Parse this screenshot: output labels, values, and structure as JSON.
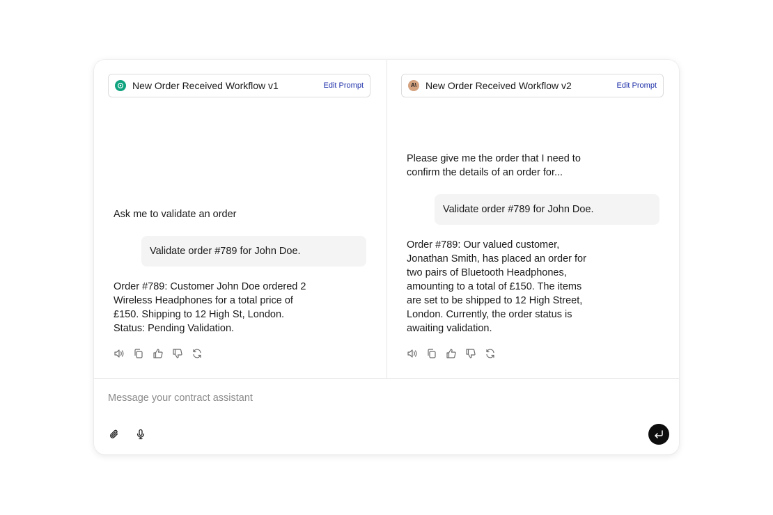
{
  "left_pane": {
    "header_title": "New Order Received Workflow v1",
    "edit_label": "Edit Prompt",
    "logo_icon": "openai-logo-icon",
    "logo_color": "#10a37f",
    "assistant_intro": "Ask me to validate an order",
    "user_message": "Validate order #789 for John Doe.",
    "assistant_reply": "Order #789: Customer John Doe ordered 2\nWireless Headphones for a total price of\n£150. Shipping to 12 High St, London.\nStatus: Pending Validation."
  },
  "right_pane": {
    "header_title": "New Order Received Workflow v2",
    "edit_label": "Edit Prompt",
    "logo_icon": "anthropic-logo-icon",
    "logo_text": "A\\",
    "logo_color": "#d4a27f",
    "assistant_intro": "Please give me the order that I need to\nconfirm the details of an order for...",
    "user_message": "Validate order #789 for John Doe.",
    "assistant_reply": "Order #789: Our valued customer,\nJonathan Smith, has placed an order for\ntwo pairs of Bluetooth Headphones,\namounting to a total of £150. The items\nare set to be shipped to 12 High Street,\nLondon. Currently, the order status is\nawaiting validation."
  },
  "message_actions": [
    "speaker-icon",
    "copy-icon",
    "thumbs-up-icon",
    "thumbs-down-icon",
    "regenerate-icon"
  ],
  "composer": {
    "placeholder": "Message your contract assistant",
    "attach_icon": "paperclip-icon",
    "mic_icon": "microphone-icon",
    "send_icon": "enter-arrow-icon"
  }
}
